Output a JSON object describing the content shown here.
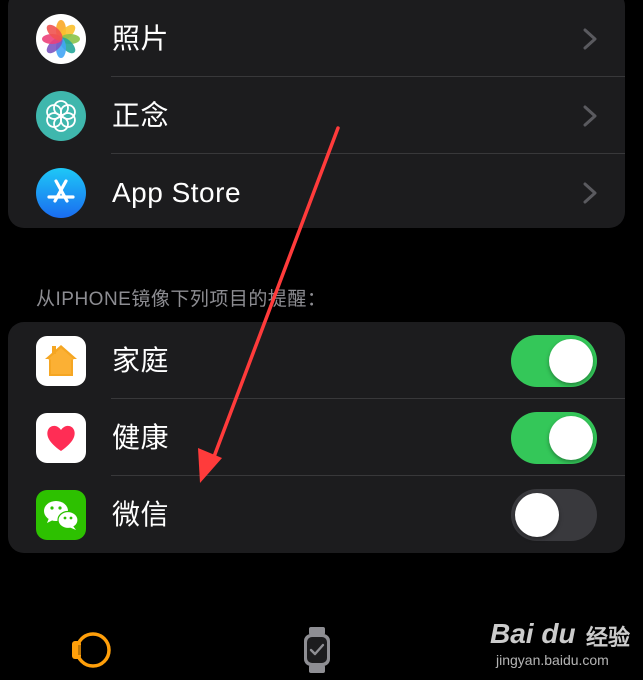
{
  "apps_list": [
    {
      "label": "照片",
      "icon": "photos-icon"
    },
    {
      "label": "正念",
      "icon": "mindfulness-icon"
    },
    {
      "label": "App Store",
      "icon": "app-store-icon"
    }
  ],
  "mirror_section": {
    "header": "从IPHONE镜像下列项目的提醒：",
    "items": [
      {
        "label": "家庭",
        "icon": "home-app-icon",
        "enabled": true
      },
      {
        "label": "健康",
        "icon": "health-app-icon",
        "enabled": true
      },
      {
        "label": "微信",
        "icon": "wechat-icon",
        "enabled": false
      }
    ]
  },
  "tab_bar": {
    "tabs": [
      {
        "icon": "watch-faces-icon",
        "selected": true
      },
      {
        "icon": "my-watch-icon",
        "selected": false
      }
    ]
  },
  "watermark": {
    "logo": "Bai du",
    "brand": "经验",
    "url": "jingyan.baidu.com"
  },
  "colors": {
    "toggle_on": "#34c759",
    "toggle_off": "#39393d",
    "row_background": "#1c1c1e",
    "annotation_arrow": "#ff3b3b",
    "tab_selected": "#ff9f0a"
  }
}
